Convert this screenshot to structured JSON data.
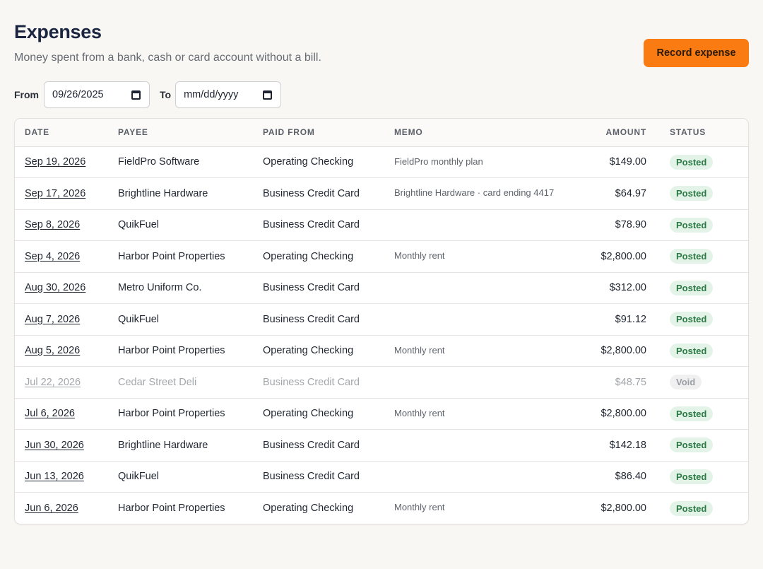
{
  "header": {
    "title": "Expenses",
    "subtitle": "Money spent from a bank, cash or card account without a bill.",
    "record_button": "Record expense"
  },
  "filters": {
    "from_label": "From",
    "from_value": "09/26/2025",
    "to_label": "To",
    "to_value": "mm/dd/yyyy"
  },
  "table": {
    "columns": [
      "DATE",
      "PAYEE",
      "PAID FROM",
      "MEMO",
      "AMOUNT",
      "STATUS"
    ],
    "rows": [
      {
        "date": "Sep 19, 2026",
        "payee": "FieldPro Software",
        "paid_from": "Operating Checking",
        "memo": "FieldPro monthly plan",
        "amount": "$149.00",
        "status": "Posted"
      },
      {
        "date": "Sep 17, 2026",
        "payee": "Brightline Hardware",
        "paid_from": "Business Credit Card",
        "memo": "Brightline Hardware · card ending 4417",
        "amount": "$64.97",
        "status": "Posted"
      },
      {
        "date": "Sep 8, 2026",
        "payee": "QuikFuel",
        "paid_from": "Business Credit Card",
        "memo": "",
        "amount": "$78.90",
        "status": "Posted"
      },
      {
        "date": "Sep 4, 2026",
        "payee": "Harbor Point Properties",
        "paid_from": "Operating Checking",
        "memo": "Monthly rent",
        "amount": "$2,800.00",
        "status": "Posted"
      },
      {
        "date": "Aug 30, 2026",
        "payee": "Metro Uniform Co.",
        "paid_from": "Business Credit Card",
        "memo": "",
        "amount": "$312.00",
        "status": "Posted"
      },
      {
        "date": "Aug 7, 2026",
        "payee": "QuikFuel",
        "paid_from": "Business Credit Card",
        "memo": "",
        "amount": "$91.12",
        "status": "Posted"
      },
      {
        "date": "Aug 5, 2026",
        "payee": "Harbor Point Properties",
        "paid_from": "Operating Checking",
        "memo": "Monthly rent",
        "amount": "$2,800.00",
        "status": "Posted"
      },
      {
        "date": "Jul 22, 2026",
        "payee": "Cedar Street Deli",
        "paid_from": "Business Credit Card",
        "memo": "",
        "amount": "$48.75",
        "status": "Void"
      },
      {
        "date": "Jul 6, 2026",
        "payee": "Harbor Point Properties",
        "paid_from": "Operating Checking",
        "memo": "Monthly rent",
        "amount": "$2,800.00",
        "status": "Posted"
      },
      {
        "date": "Jun 30, 2026",
        "payee": "Brightline Hardware",
        "paid_from": "Business Credit Card",
        "memo": "",
        "amount": "$142.18",
        "status": "Posted"
      },
      {
        "date": "Jun 13, 2026",
        "payee": "QuikFuel",
        "paid_from": "Business Credit Card",
        "memo": "",
        "amount": "$86.40",
        "status": "Posted"
      },
      {
        "date": "Jun 6, 2026",
        "payee": "Harbor Point Properties",
        "paid_from": "Operating Checking",
        "memo": "Monthly rent",
        "amount": "$2,800.00",
        "status": "Posted"
      }
    ]
  },
  "colors": {
    "accent": "#fb7b13",
    "posted_bg": "#e3f3e7",
    "posted_text": "#2b7a45",
    "void_bg": "#f0f0f1",
    "void_text": "#9a9ea4"
  },
  "icons": [
    "calendar-icon"
  ]
}
